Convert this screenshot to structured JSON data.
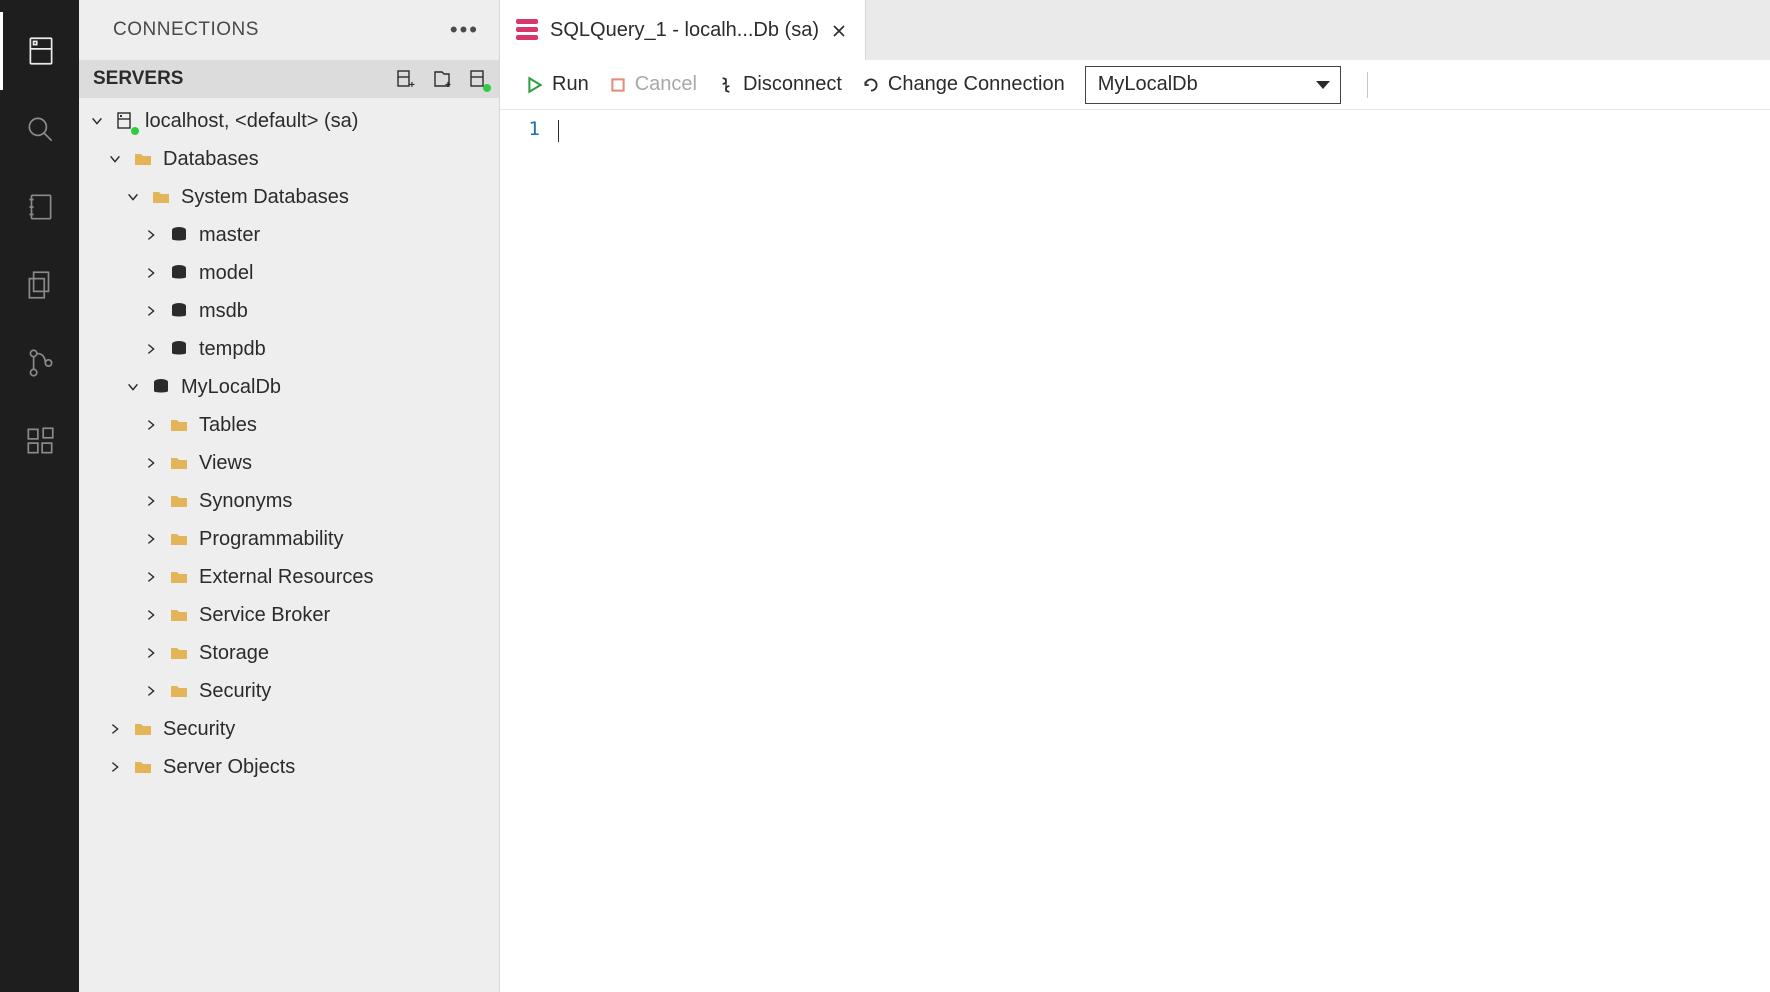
{
  "sidePanel": {
    "title": "CONNECTIONS",
    "serversHeader": "SERVERS"
  },
  "tree": {
    "server": "localhost, <default> (sa)",
    "databasesFolder": "Databases",
    "systemDatabasesFolder": "System Databases",
    "sysDbs": {
      "master": "master",
      "model": "model",
      "msdb": "msdb",
      "tempdb": "tempdb"
    },
    "userDb": "MyLocalDb",
    "userDbChildren": {
      "tables": "Tables",
      "views": "Views",
      "synonyms": "Synonyms",
      "programmability": "Programmability",
      "externalResources": "External Resources",
      "serviceBroker": "Service Broker",
      "storage": "Storage",
      "security": "Security"
    },
    "serverChildren": {
      "security": "Security",
      "serverObjects": "Server Objects"
    }
  },
  "editor": {
    "tabTitle": "SQLQuery_1 - localh...Db (sa)",
    "toolbar": {
      "run": "Run",
      "cancel": "Cancel",
      "disconnect": "Disconnect",
      "changeConnection": "Change Connection",
      "dbSelected": "MyLocalDb"
    },
    "gutter": {
      "line1": "1"
    }
  }
}
